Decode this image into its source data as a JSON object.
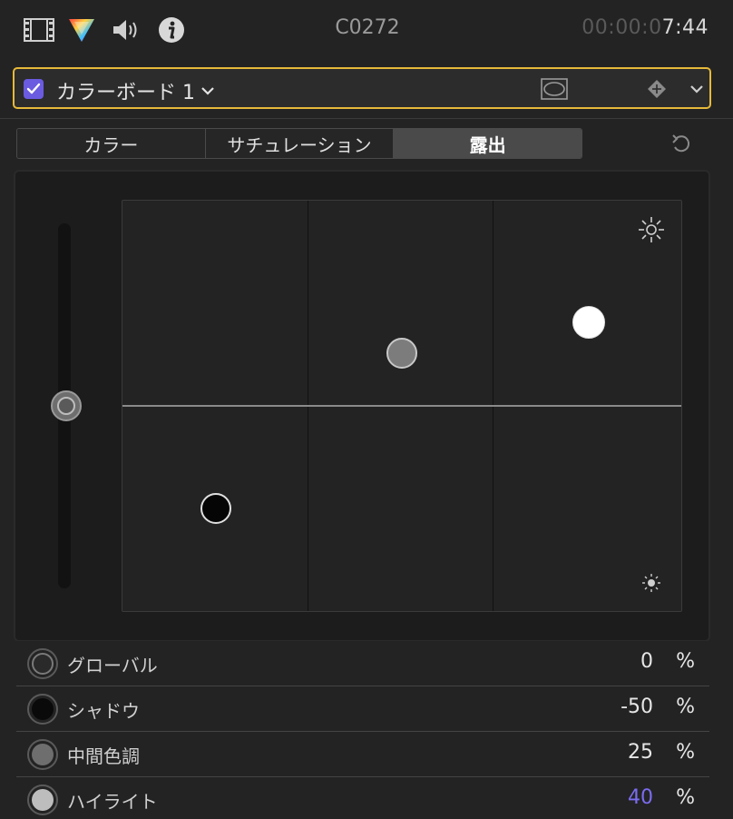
{
  "topbar": {
    "clip_name": "C0272",
    "timecode_dim": "00:00:0",
    "timecode_lit": "7:44",
    "icons": [
      "film-icon",
      "color-inspector-icon",
      "audio-icon",
      "info-icon"
    ]
  },
  "effect": {
    "enabled": true,
    "title": "カラーボード 1",
    "accent_color": "#e6b93a",
    "checkbox_color": "#6a5be0"
  },
  "tabs": [
    {
      "label": "カラー",
      "active": false
    },
    {
      "label": "サチュレーション",
      "active": false
    },
    {
      "label": "露出",
      "active": true
    }
  ],
  "rows": [
    {
      "label": "グローバル",
      "value": "0",
      "unit": "%",
      "value_color": "#e6e6e6",
      "swatch": "#2a2a2a",
      "swatch_ring": true
    },
    {
      "label": "シャドウ",
      "value": "-50",
      "unit": "%",
      "value_color": "#e6e6e6",
      "swatch": "#0a0a0a",
      "swatch_ring": false
    },
    {
      "label": "中間色調",
      "value": "25",
      "unit": "%",
      "value_color": "#e6e6e6",
      "swatch": "#6e6e6e",
      "swatch_ring": false
    },
    {
      "label": "ハイライト",
      "value": "40",
      "unit": "%",
      "value_color": "#7b6cf0",
      "swatch": "#bdbdbd",
      "swatch_ring": false
    }
  ]
}
